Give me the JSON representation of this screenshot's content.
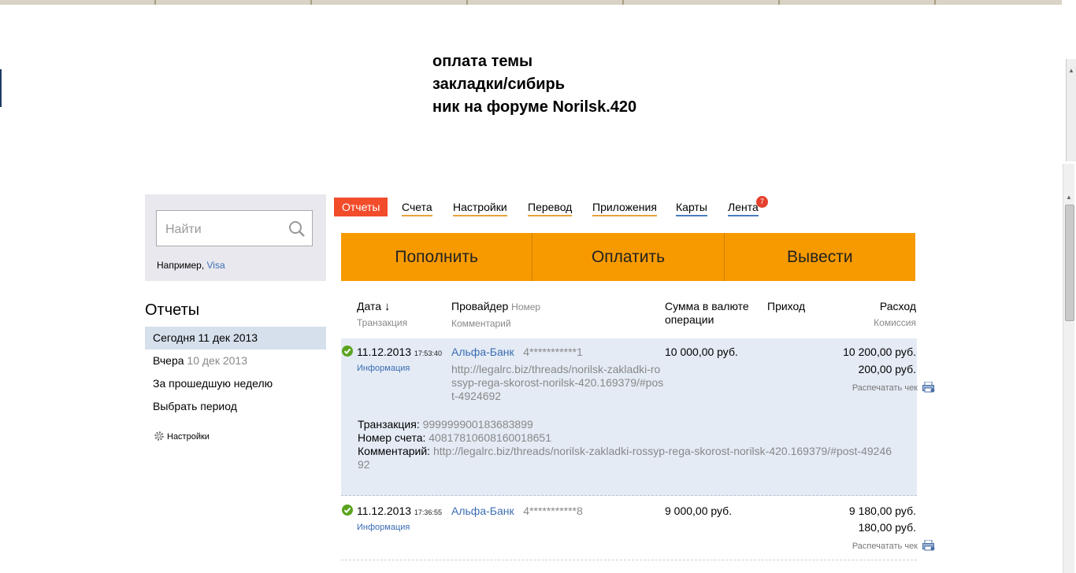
{
  "note": {
    "line1": "оплата темы",
    "line2": "закладки/сибирь",
    "line3": "ник на форуме Norilsk.420"
  },
  "search": {
    "placeholder": "Найти",
    "hint_prefix": "Например, ",
    "hint_example": "Visa"
  },
  "sidebar": {
    "title": "Отчеты",
    "items": [
      {
        "label": "Сегодня 11 дек 2013",
        "extra": ""
      },
      {
        "label": "Вчера ",
        "extra": "10 дек 2013"
      },
      {
        "label": "За прошедшую неделю",
        "extra": ""
      },
      {
        "label": "Выбрать период",
        "extra": ""
      }
    ],
    "settings_label": "Настройки"
  },
  "tabs": [
    {
      "label": "Отчеты"
    },
    {
      "label": "Счета"
    },
    {
      "label": "Настройки"
    },
    {
      "label": "Перевод"
    },
    {
      "label": "Приложения"
    },
    {
      "label": "Карты"
    },
    {
      "label": "Лента"
    }
  ],
  "feed_badge": "7",
  "actions": {
    "topup": "Пополнить",
    "pay": "Оплатить",
    "withdraw": "Вывести"
  },
  "table": {
    "headers": {
      "date": "Дата",
      "date_arrow": "↓",
      "date_sub": "Транзакция",
      "provider": "Провайдер",
      "provider_extra": "Номер",
      "provider_sub": "Комментарий",
      "sum_line1": "Сумма в валюте",
      "sum_line2": "операции",
      "income": "Приход",
      "expense": "Расход",
      "expense_sub": "Комиссия"
    },
    "rows": [
      {
        "date": "11.12.2013",
        "time": "17:53:40",
        "info": "Информация",
        "provider": "Альфа-Банк",
        "number": "4***********1",
        "comment": "http://legalrc.biz/threads/norilsk-zakladki-rossyp-rega-skorost-norilsk-420.169379/#post-4924692",
        "sum": "10 000,00 руб.",
        "expense": "10 200,00 руб.",
        "commission": "200,00 руб.",
        "print": "Распечатать чек",
        "details": {
          "txn_label": "Транзакция: ",
          "txn_value": "999999900183683899",
          "account_label": "Номер счета: ",
          "account_value": "40817810608160018651",
          "comment_label": "Комментарий: ",
          "comment_value": "http://legalrc.biz/threads/norilsk-zakladki-rossyp-rega-skorost-norilsk-420.169379/#post-4924692"
        }
      },
      {
        "date": "11.12.2013",
        "time": "17:36:55",
        "info": "Информация",
        "provider": "Альфа-Банк",
        "number": "4***********8",
        "sum": "9 000,00 руб.",
        "expense": "9 180,00 руб.",
        "commission": "180,00 руб.",
        "print": "Распечатать чек"
      }
    ]
  },
  "colors": {
    "accent_orange": "#f79a00",
    "active_tab": "#f24c2b",
    "link_blue": "#3b6db3",
    "expanded_row": "#e4ebf5"
  }
}
